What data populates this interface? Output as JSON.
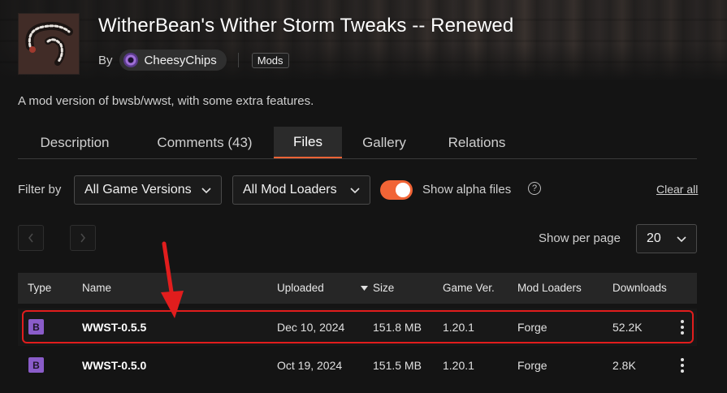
{
  "project": {
    "title": "WitherBean's Wither Storm Tweaks -- Renewed",
    "by_label": "By",
    "author": "CheesyChips",
    "tag": "Mods",
    "summary": "A mod version of bwsb/wwst, with some extra features."
  },
  "tabs": [
    {
      "label": "Description",
      "active": false
    },
    {
      "label": "Comments (43)",
      "active": false
    },
    {
      "label": "Files",
      "active": true
    },
    {
      "label": "Gallery",
      "active": false
    },
    {
      "label": "Relations",
      "active": false
    }
  ],
  "filters": {
    "label": "Filter by",
    "game_version": "All Game Versions",
    "mod_loader": "All Mod Loaders",
    "show_alpha_label": "Show alpha files",
    "show_alpha_enabled": true,
    "help_glyph": "?",
    "clear_all": "Clear all"
  },
  "pagination": {
    "per_page_label": "Show per page",
    "per_page_value": "20"
  },
  "table": {
    "headers": [
      "Type",
      "Name",
      "Uploaded",
      "Size",
      "Game Ver.",
      "Mod Loaders",
      "Downloads"
    ],
    "rows": [
      {
        "type": "B",
        "name": "WWST-0.5.5",
        "uploaded": "Dec 10, 2024",
        "size": "151.8 MB",
        "game_ver": "1.20.1",
        "loader": "Forge",
        "downloads": "52.2K",
        "highlighted": true
      },
      {
        "type": "B",
        "name": "WWST-0.5.0",
        "uploaded": "Oct 19, 2024",
        "size": "151.5 MB",
        "game_ver": "1.20.1",
        "loader": "Forge",
        "downloads": "2.8K",
        "highlighted": false
      }
    ]
  },
  "colors": {
    "accent": "#f16436",
    "beta_badge": "#8a5cc9",
    "annotation": "#e11d1d",
    "background": "#141414"
  },
  "icons": [
    "project-logo",
    "author-avatar",
    "chevron-down-icon",
    "help-icon",
    "chevron-left-icon",
    "chevron-right-icon",
    "sort-down-icon",
    "kebab-menu-icon",
    "annotation-arrow"
  ]
}
